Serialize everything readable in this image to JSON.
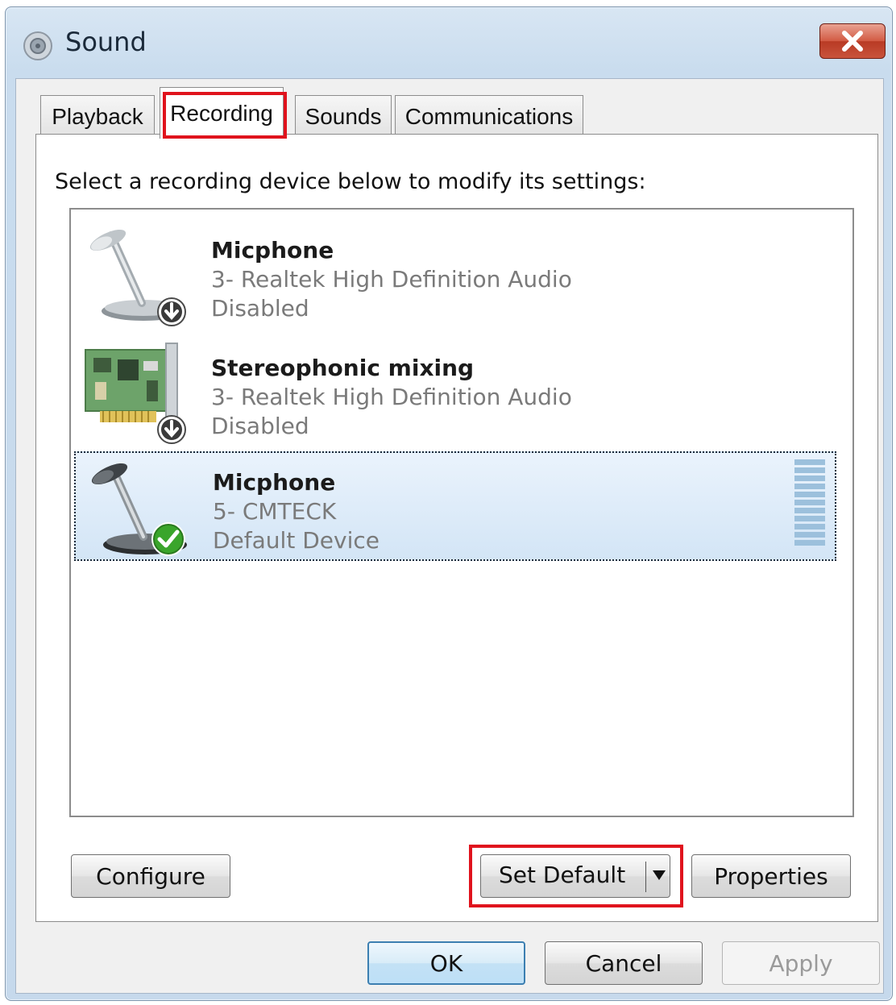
{
  "window": {
    "title": "Sound",
    "title_icon": "speaker-icon",
    "close_icon": "close-icon"
  },
  "tabs": [
    {
      "label": "Playback",
      "active": false
    },
    {
      "label": "Recording",
      "active": true
    },
    {
      "label": "Sounds",
      "active": false
    },
    {
      "label": "Communications",
      "active": false
    }
  ],
  "recording": {
    "instruction": "Select a recording device below to modify its settings:",
    "devices": [
      {
        "name": "Micphone",
        "driver": "3- Realtek High Definition Audio",
        "status": "Disabled",
        "icon": "microphone-icon",
        "badge": "disabled-arrow-icon",
        "selected": false
      },
      {
        "name": "Stereophonic mixing",
        "driver": "3- Realtek High Definition Audio",
        "status": "Disabled",
        "icon": "sound-card-icon",
        "badge": "disabled-arrow-icon",
        "selected": false
      },
      {
        "name": "Micphone",
        "driver": "5- CMTECK",
        "status": "Default Device",
        "icon": "microphone-icon",
        "badge": "default-check-icon",
        "selected": true
      }
    ],
    "buttons": {
      "configure": "Configure",
      "set_default": "Set Default",
      "properties": "Properties"
    }
  },
  "footer": {
    "ok": "OK",
    "cancel": "Cancel",
    "apply": "Apply"
  },
  "colors": {
    "highlight": "#e0131d",
    "selection": "#d3e5f6",
    "close_button": "#c9543c",
    "check_badge": "#3aa52b"
  }
}
